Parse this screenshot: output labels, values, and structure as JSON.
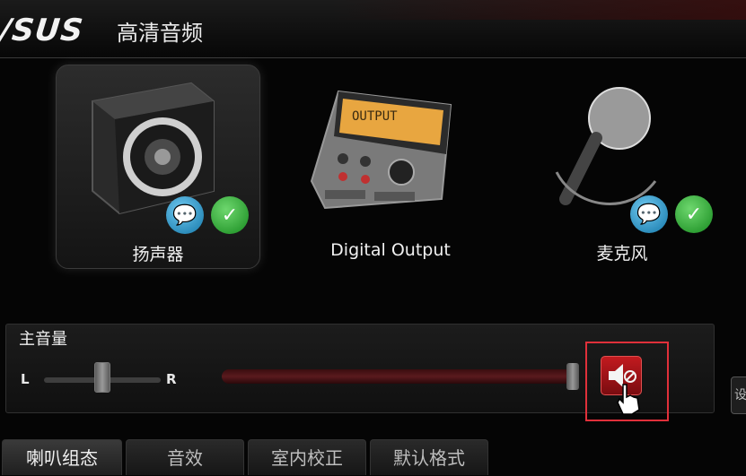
{
  "header": {
    "logo": "/SUS",
    "title": "高清音频"
  },
  "devices": [
    {
      "label": "扬声器",
      "selected": true,
      "icons": [
        "speaker-icon",
        "chat-bubble-icon",
        "check-icon"
      ]
    },
    {
      "label": "Digital Output",
      "selected": false,
      "icons": [
        "audio-interface-icon"
      ],
      "panel_text": "OUTPUT"
    },
    {
      "label": "麦克风",
      "selected": false,
      "icons": [
        "microphone-icon",
        "chat-bubble-icon",
        "check-icon"
      ]
    }
  ],
  "volume": {
    "title": "主音量",
    "left_label": "L",
    "right_label": "R",
    "balance": 0.5,
    "level": 0.98,
    "mute_icon": "speaker-mute-icon"
  },
  "side_tab": "设",
  "tabs": [
    {
      "label": "喇叭组态",
      "active": true
    },
    {
      "label": "音效",
      "active": false
    },
    {
      "label": "室内校正",
      "active": false
    },
    {
      "label": "默认格式",
      "active": false
    }
  ],
  "colors": {
    "accent_red": "#c21a1f",
    "highlight": "#e0303a",
    "check_green": "#168a1e",
    "chat_blue": "#1477a8"
  }
}
